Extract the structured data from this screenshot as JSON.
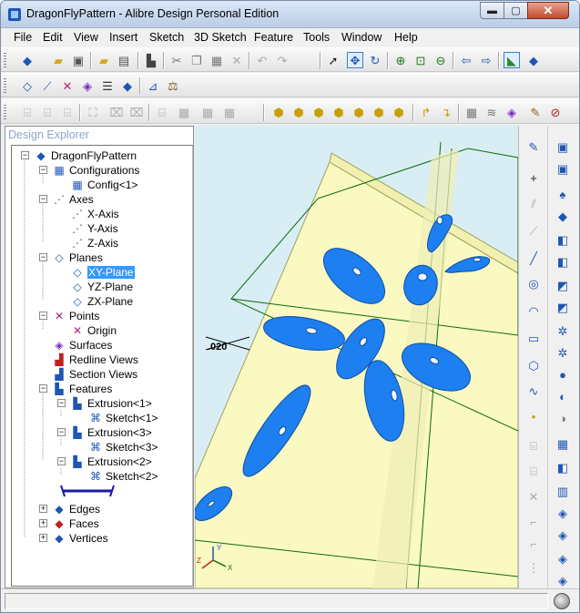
{
  "window": {
    "title": "DragonFlyPattern - Alibre Design Personal Edition",
    "min_glyph": "▬",
    "max_glyph": "▢",
    "close_glyph": "✕"
  },
  "menu": [
    "File",
    "Edit",
    "View",
    "Insert",
    "Sketch",
    "3D Sketch",
    "Feature",
    "Tools",
    "Window",
    "Help"
  ],
  "explorer": {
    "title": "Design Explorer",
    "root": "DragonFlyPattern",
    "configurations": "Configurations",
    "config1": "Config<1>",
    "axes": "Axes",
    "x_axis": "X-Axis",
    "y_axis": "Y-Axis",
    "z_axis": "Z-Axis",
    "planes": "Planes",
    "xy_plane": "XY-Plane",
    "yz_plane": "YZ-Plane",
    "zx_plane": "ZX-Plane",
    "points": "Points",
    "origin": "Origin",
    "surfaces": "Surfaces",
    "redline_views": "Redline Views",
    "section_views": "Section Views",
    "features": "Features",
    "extrusion1": "Extrusion<1>",
    "sketch1": "Sketch<1>",
    "extrusion3": "Extrusion<3>",
    "sketch3": "Sketch<3>",
    "extrusion2": "Extrusion<2>",
    "sketch2": "Sketch<2>",
    "edges": "Edges",
    "faces": "Faces",
    "vertices": "Vertices"
  },
  "viewport": {
    "dimension_label": ".020",
    "axis_labels": {
      "x": "X",
      "y": "Y",
      "z": "Z"
    },
    "colors": {
      "background": "#d9eef4",
      "plate": "#fbf9c2",
      "features": "#1e7ff0",
      "outline": "#0a6a0a"
    }
  },
  "statusbar": {
    "text": ""
  }
}
